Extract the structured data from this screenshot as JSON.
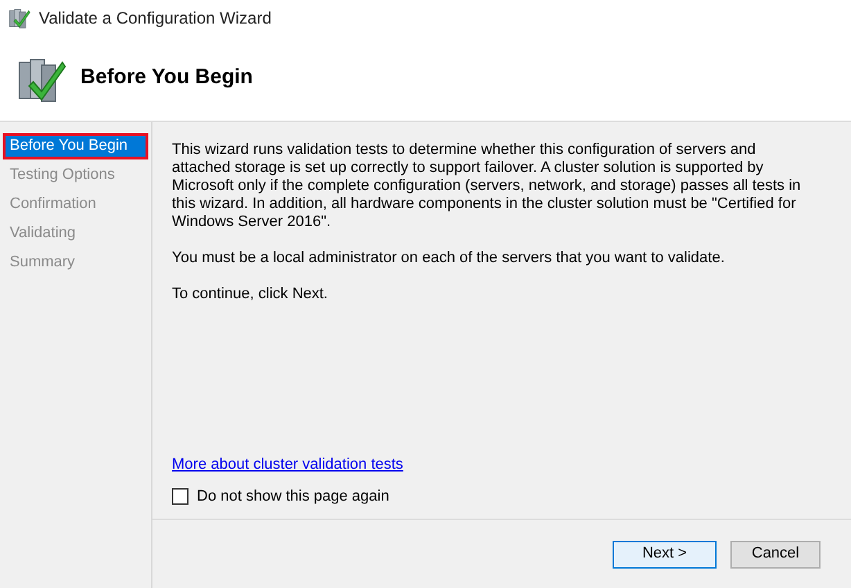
{
  "window": {
    "title": "Validate a Configuration Wizard"
  },
  "header": {
    "title": "Before You Begin"
  },
  "steps": [
    {
      "label": "Before You Begin",
      "selected": true
    },
    {
      "label": "Testing Options",
      "selected": false
    },
    {
      "label": "Confirmation",
      "selected": false
    },
    {
      "label": "Validating",
      "selected": false
    },
    {
      "label": "Summary",
      "selected": false
    }
  ],
  "paragraphs": [
    "This wizard runs validation tests to determine whether this configuration of servers and attached storage is set up correctly to support failover. A cluster solution is supported by Microsoft only if the complete configuration (servers, network, and storage) passes all tests in this wizard. In addition, all hardware components in the cluster solution must be \"Certified for Windows Server 2016\".",
    "You must be a local administrator on each of the servers that you want to validate.",
    "To continue, click Next."
  ],
  "link": "More about cluster validation tests",
  "checkbox": {
    "label": "Do not show this page again",
    "checked": false
  },
  "buttons": [
    {
      "label": "Next >",
      "kind": "default"
    },
    {
      "label": "Cancel",
      "kind": "normal"
    }
  ]
}
